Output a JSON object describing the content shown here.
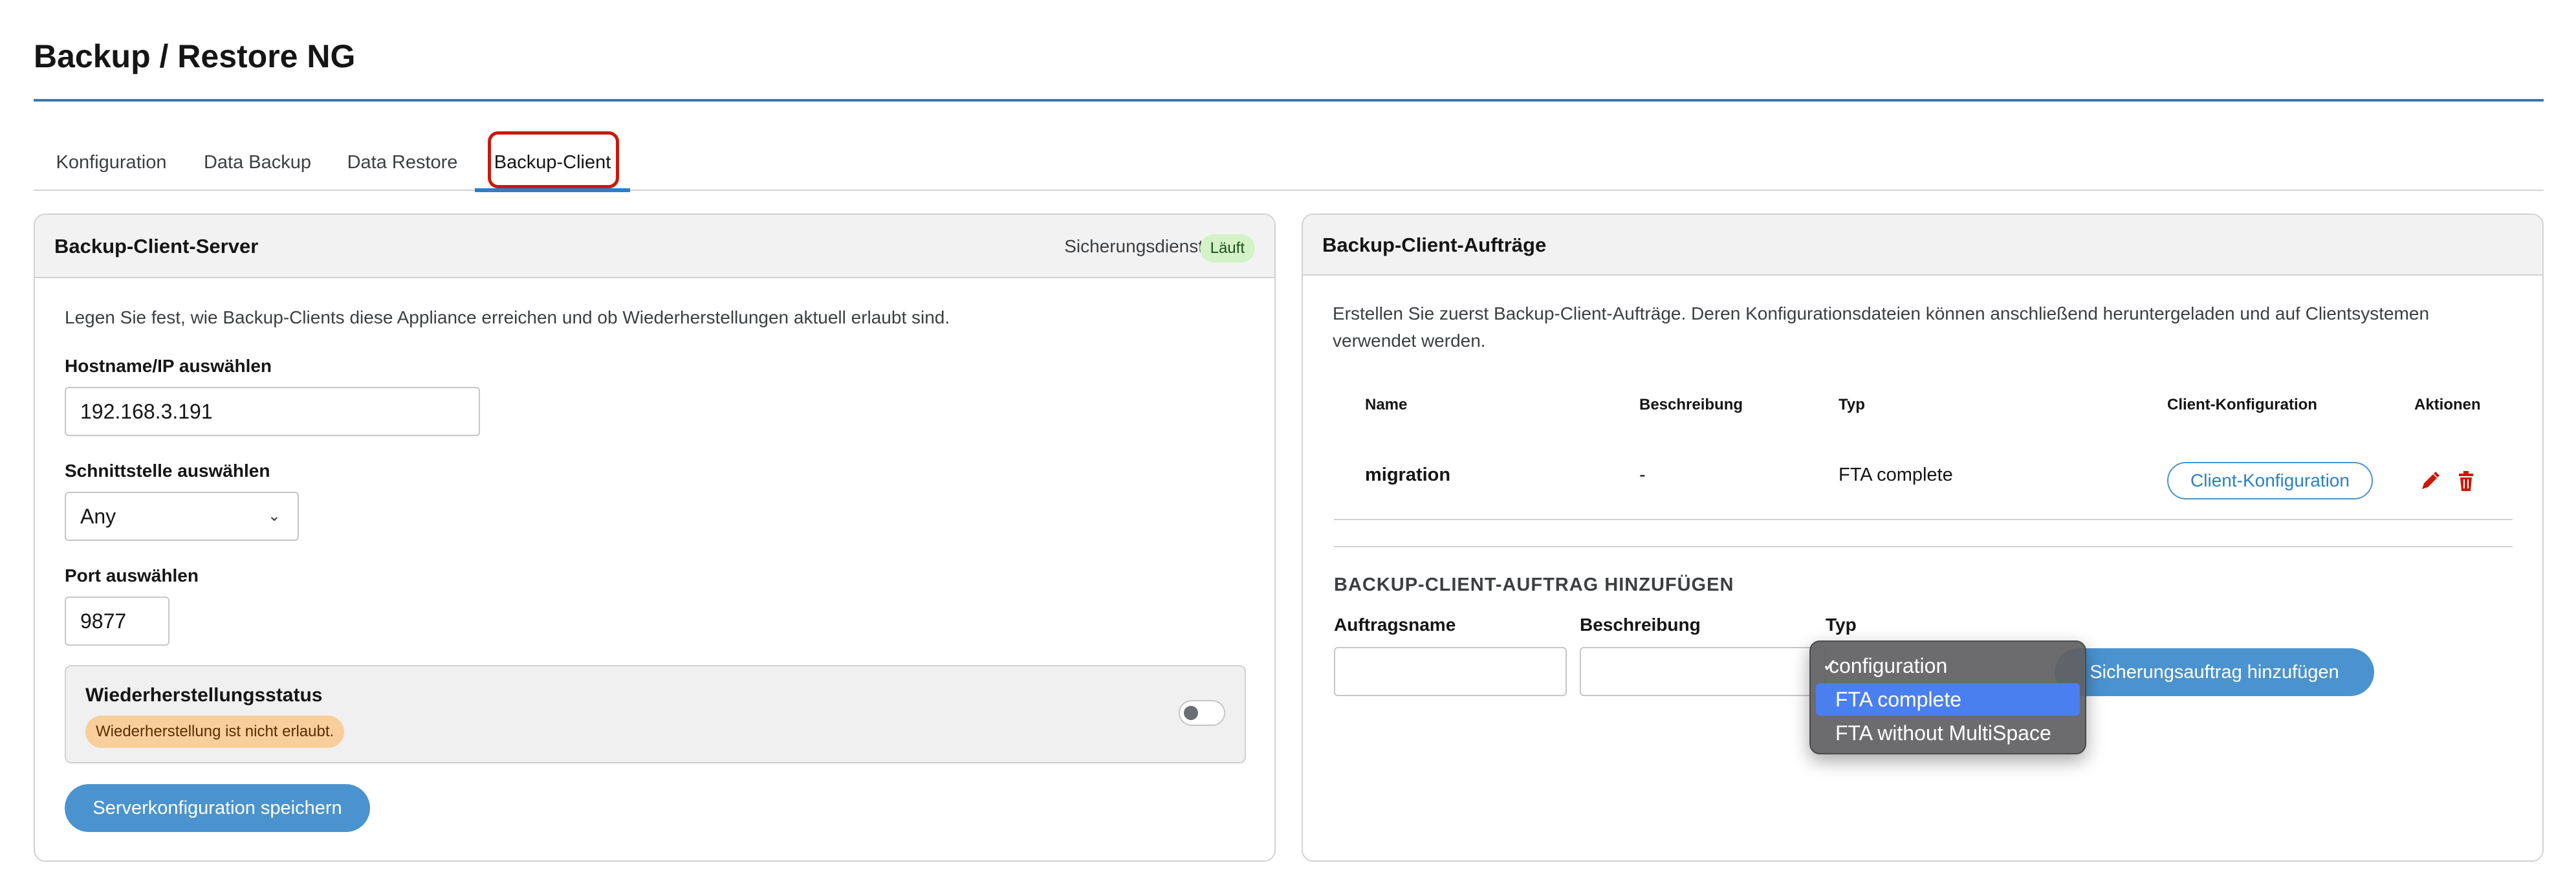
{
  "page": {
    "title": "Backup / Restore NG"
  },
  "tabs": [
    {
      "label": "Konfiguration"
    },
    {
      "label": "Data Backup"
    },
    {
      "label": "Data Restore"
    },
    {
      "label": "Backup-Client",
      "active": true
    }
  ],
  "server_card": {
    "title": "Backup-Client-Server",
    "service_label": "Sicherungsdienst",
    "service_status": "Läuft",
    "description": "Legen Sie fest, wie Backup-Clients diese Appliance erreichen und ob Wiederherstellungen aktuell erlaubt sind.",
    "hostname_label": "Hostname/IP auswählen",
    "hostname_value": "192.168.3.191",
    "interface_label": "Schnittstelle auswählen",
    "interface_value": "Any",
    "port_label": "Port auswählen",
    "port_value": "9877",
    "restore_status_title": "Wiederherstellungsstatus",
    "restore_status_badge": "Wiederherstellung ist nicht erlaubt.",
    "restore_toggle_on": false,
    "save_button": "Serverkonfiguration speichern"
  },
  "jobs_card": {
    "title": "Backup-Client-Aufträge",
    "description": "Erstellen Sie zuerst Backup-Client-Aufträge. Deren Konfigurationsdateien können anschließend heruntergeladen und auf Clientsystemen verwendet werden.",
    "columns": [
      "Name",
      "Beschreibung",
      "Typ",
      "Client-Konfiguration",
      "Aktionen"
    ],
    "rows": [
      {
        "name": "migration",
        "description": "-",
        "type": "FTA complete",
        "config_button": "Client-Konfiguration"
      }
    ],
    "add_section": {
      "heading": "BACKUP-CLIENT-AUFTRAG HINZUFÜGEN",
      "name_label": "Auftragsname",
      "name_value": "",
      "description_label": "Beschreibung",
      "description_value": "",
      "type_label": "Typ",
      "add_button": "Sicherungsauftrag hinzufügen"
    }
  },
  "type_dropdown": {
    "options": [
      "configuration",
      "FTA complete",
      "FTA without MultiSpace"
    ],
    "checked_option": "configuration",
    "highlighted_option": "FTA complete",
    "check_mark": "✓"
  },
  "colors": {
    "accent": "#2b7fc7",
    "primary_button": "#4a93cf",
    "running_badge": "#d3f2c8",
    "warning_badge": "#f8cf9a",
    "danger_icon": "#c9190b",
    "dropdown_highlight": "#4a7ff0"
  },
  "icons": {
    "edit": "pencil-icon",
    "delete": "trash-icon",
    "select": "chevron-down-icon"
  }
}
